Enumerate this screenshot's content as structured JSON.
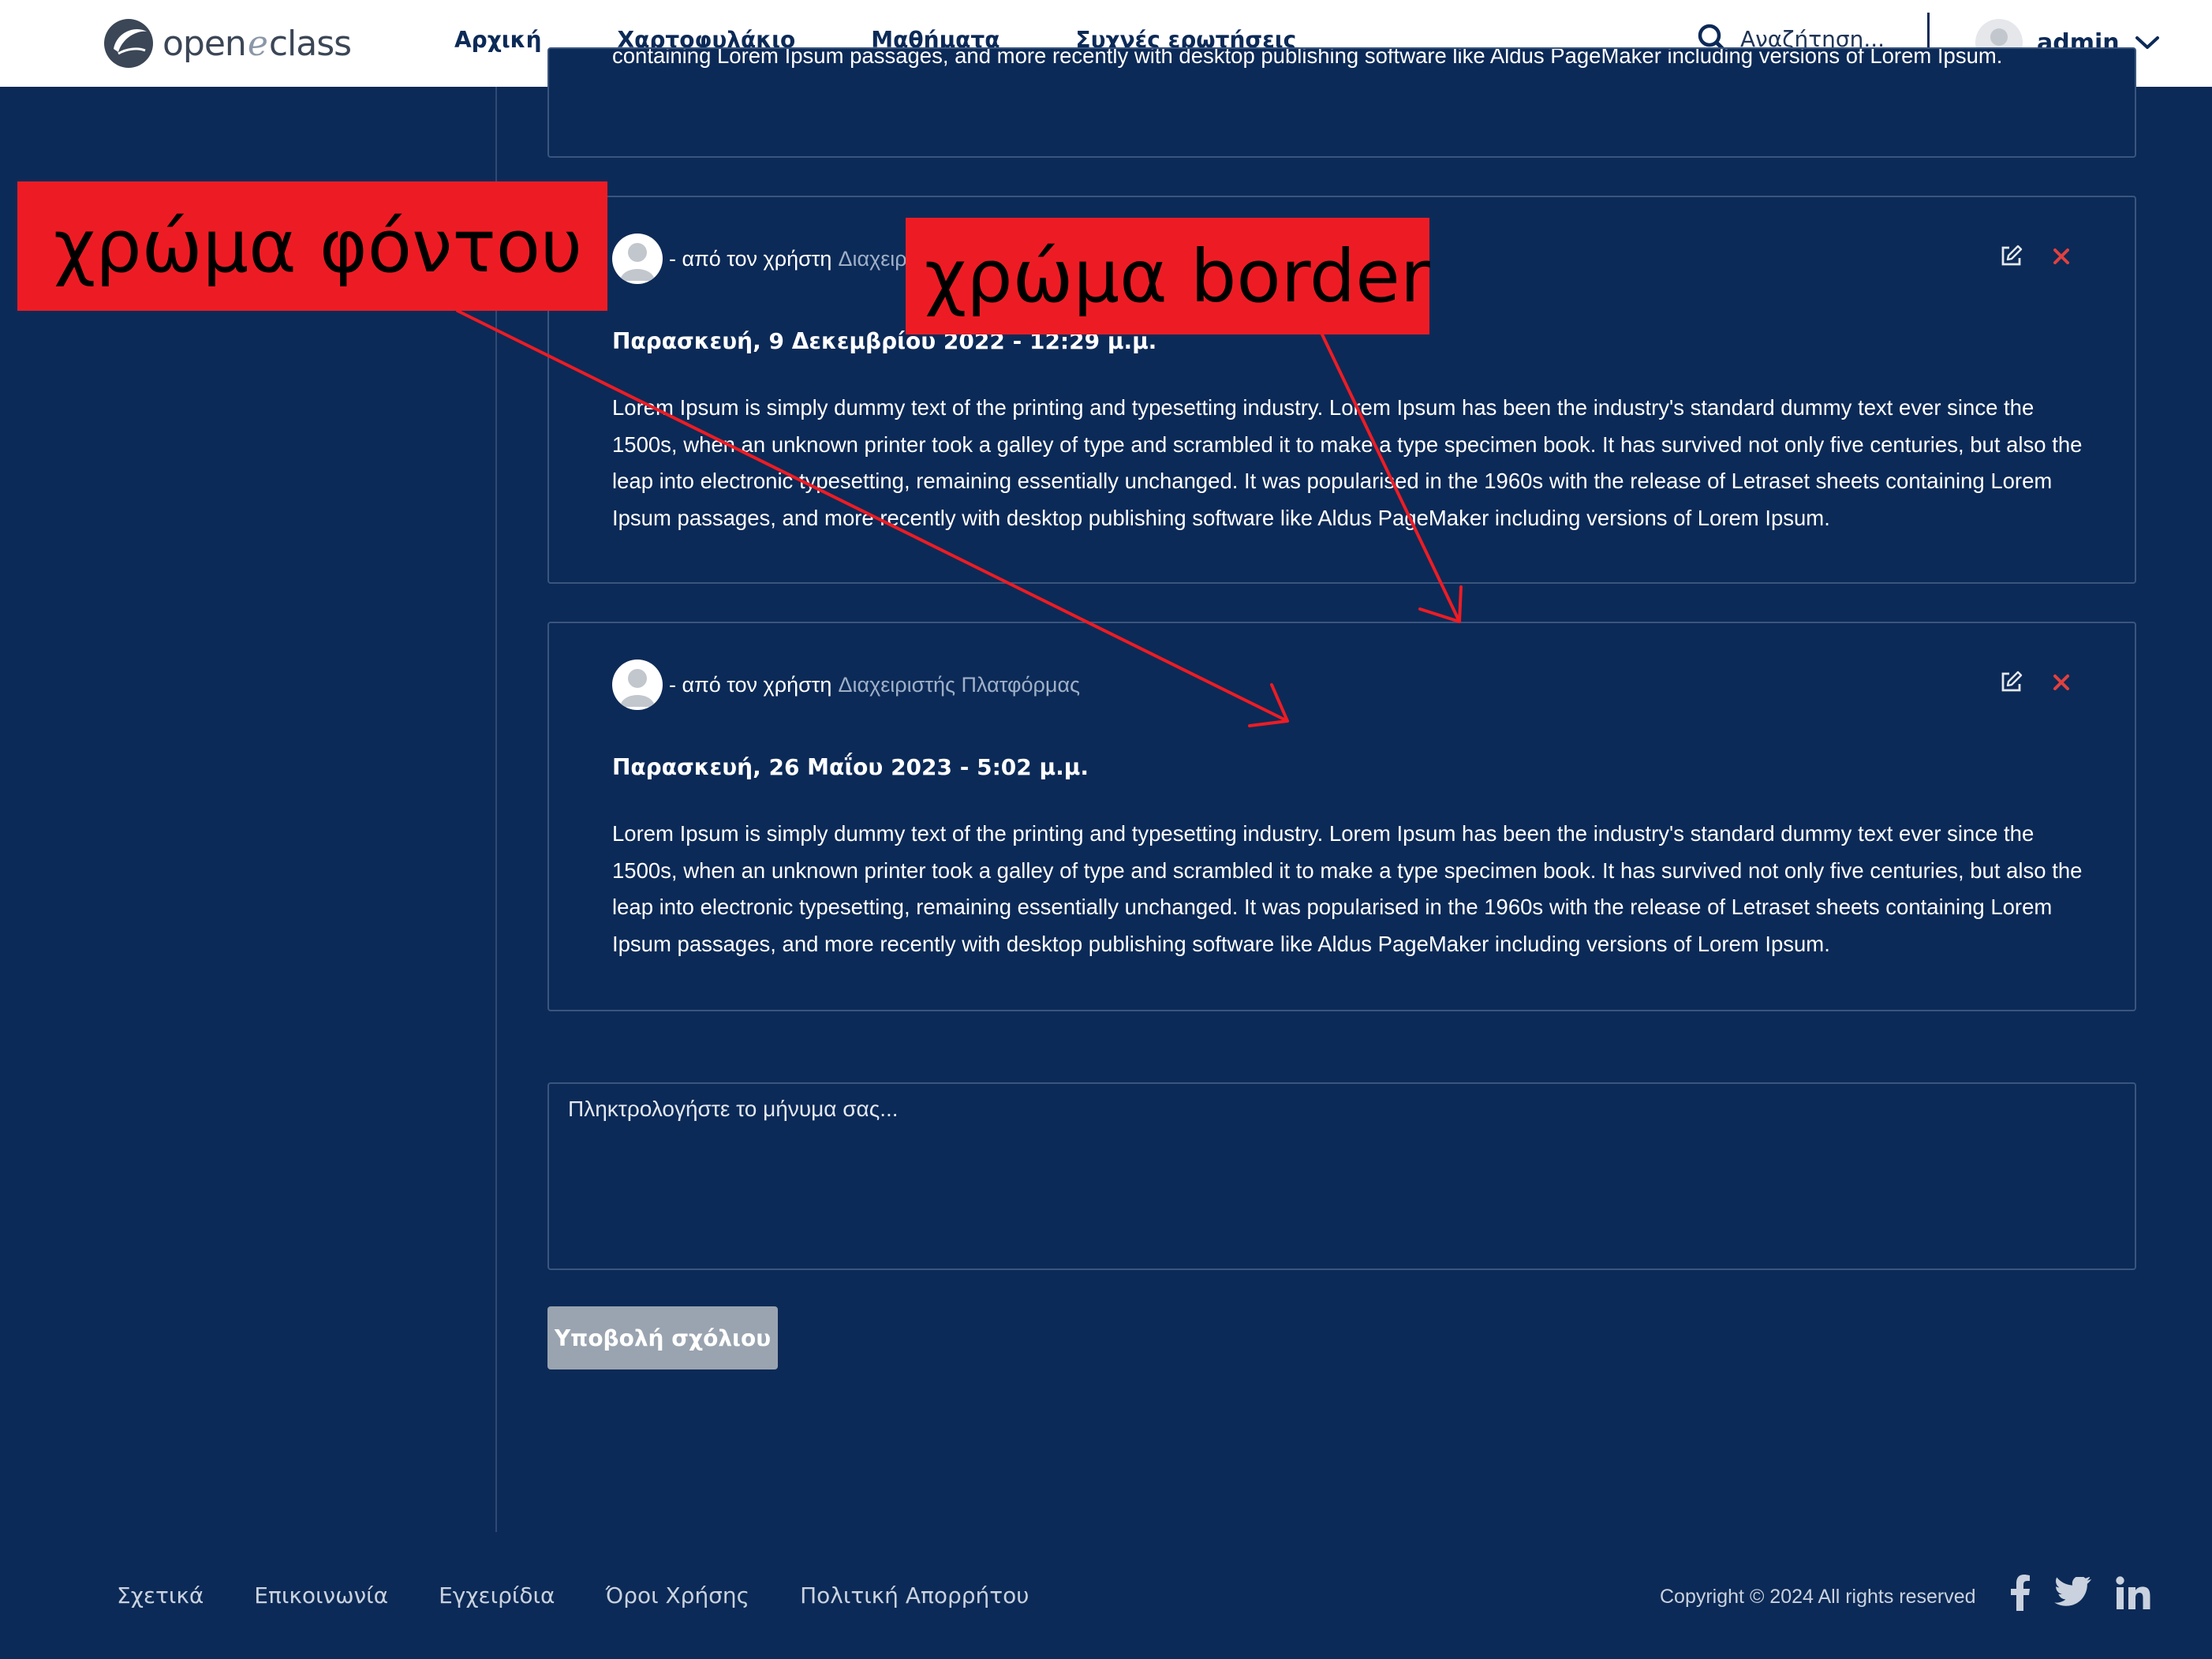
{
  "header": {
    "logo": {
      "text_left": "open",
      "text_e": "e",
      "text_right": "class"
    },
    "nav": [
      {
        "label": "Αρχική"
      },
      {
        "label": "Χαρτοφυλάκιο"
      },
      {
        "label": "Μαθήματα"
      },
      {
        "label": "Συχνές ερωτήσεις"
      }
    ],
    "search": {
      "placeholder": "Αναζήτηση..."
    },
    "user": {
      "name": "admin"
    }
  },
  "comments": [
    {
      "body": "containing Lorem Ipsum passages, and more recently with desktop publishing software like Aldus PageMaker including versions of Lorem Ipsum."
    },
    {
      "by_label": "- από τον χρήστη",
      "author": "Διαχειριστής Πλατφόρμας",
      "date": "Παρασκευή, 9 Δεκεμβρίου 2022 - 12:29 μ.μ.",
      "body": "Lorem Ipsum is simply dummy text of the printing and typesetting industry. Lorem Ipsum has been the industry's standard dummy text ever since the 1500s, when an unknown printer took a galley of type and scrambled it to make a type specimen book. It has survived not only five centuries, but also the leap into electronic typesetting, remaining essentially unchanged. It was popularised in the 1960s with the release of Letraset sheets containing Lorem Ipsum passages, and more recently with desktop publishing software like Aldus PageMaker including versions of Lorem Ipsum."
    },
    {
      "by_label": "- από τον χρήστη",
      "author": "Διαχειριστής Πλατφόρμας",
      "date": "Παρασκευή, 26 Μαΐου 2023 - 5:02 μ.μ.",
      "body": "Lorem Ipsum is simply dummy text of the printing and typesetting industry. Lorem Ipsum has been the industry's standard dummy text ever since the 1500s, when an unknown printer took a galley of type and scrambled it to make a type specimen book. It has survived not only five centuries, but also the leap into electronic typesetting, remaining essentially unchanged. It was popularised in the 1960s with the release of Letraset sheets containing Lorem Ipsum passages, and more recently with desktop publishing software like Aldus PageMaker including versions of Lorem Ipsum."
    }
  ],
  "comment_form": {
    "placeholder": "Πληκτρολογήστε το μήνυμα σας...",
    "submit_label": "Υποβολή σχόλιου"
  },
  "footer": {
    "links": [
      {
        "label": "Σχετικά"
      },
      {
        "label": "Επικοινωνία"
      },
      {
        "label": "Εγχειρίδια"
      },
      {
        "label": "Όροι Χρήσης"
      },
      {
        "label": "Πολιτική Απορρήτου"
      }
    ],
    "copyright": "Copyright © 2024 All rights reserved"
  },
  "annotations": {
    "background_label": "χρώμα φόντου",
    "border_label": "χρώμα border"
  },
  "colors": {
    "page_bg": "#0c2a57",
    "card_border": "#3a557e",
    "annotation": "#ed1c24",
    "delete_icon": "#e0413f",
    "submit_bg": "#9aa4b0"
  },
  "icons": [
    "logo-mark-icon",
    "search-icon",
    "user-avatar-icon",
    "chevron-down-icon",
    "edit-icon",
    "delete-icon",
    "facebook-icon",
    "twitter-icon",
    "linkedin-icon"
  ]
}
